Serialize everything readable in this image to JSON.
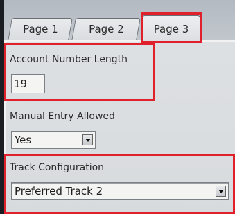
{
  "tabs": [
    {
      "label": "Page 1"
    },
    {
      "label": "Page 2"
    },
    {
      "label": "Page 3",
      "selected": true
    }
  ],
  "fields": {
    "account_number_length": {
      "label": "Account Number Length",
      "value": "19"
    },
    "manual_entry_allowed": {
      "label": "Manual Entry Allowed",
      "selected": "Yes"
    },
    "track_configuration": {
      "label": "Track Configuration",
      "selected": "Preferred Track 2"
    }
  },
  "highlight_color": "#e0202a",
  "icons": {
    "dropdown": "chevron-down-icon"
  }
}
